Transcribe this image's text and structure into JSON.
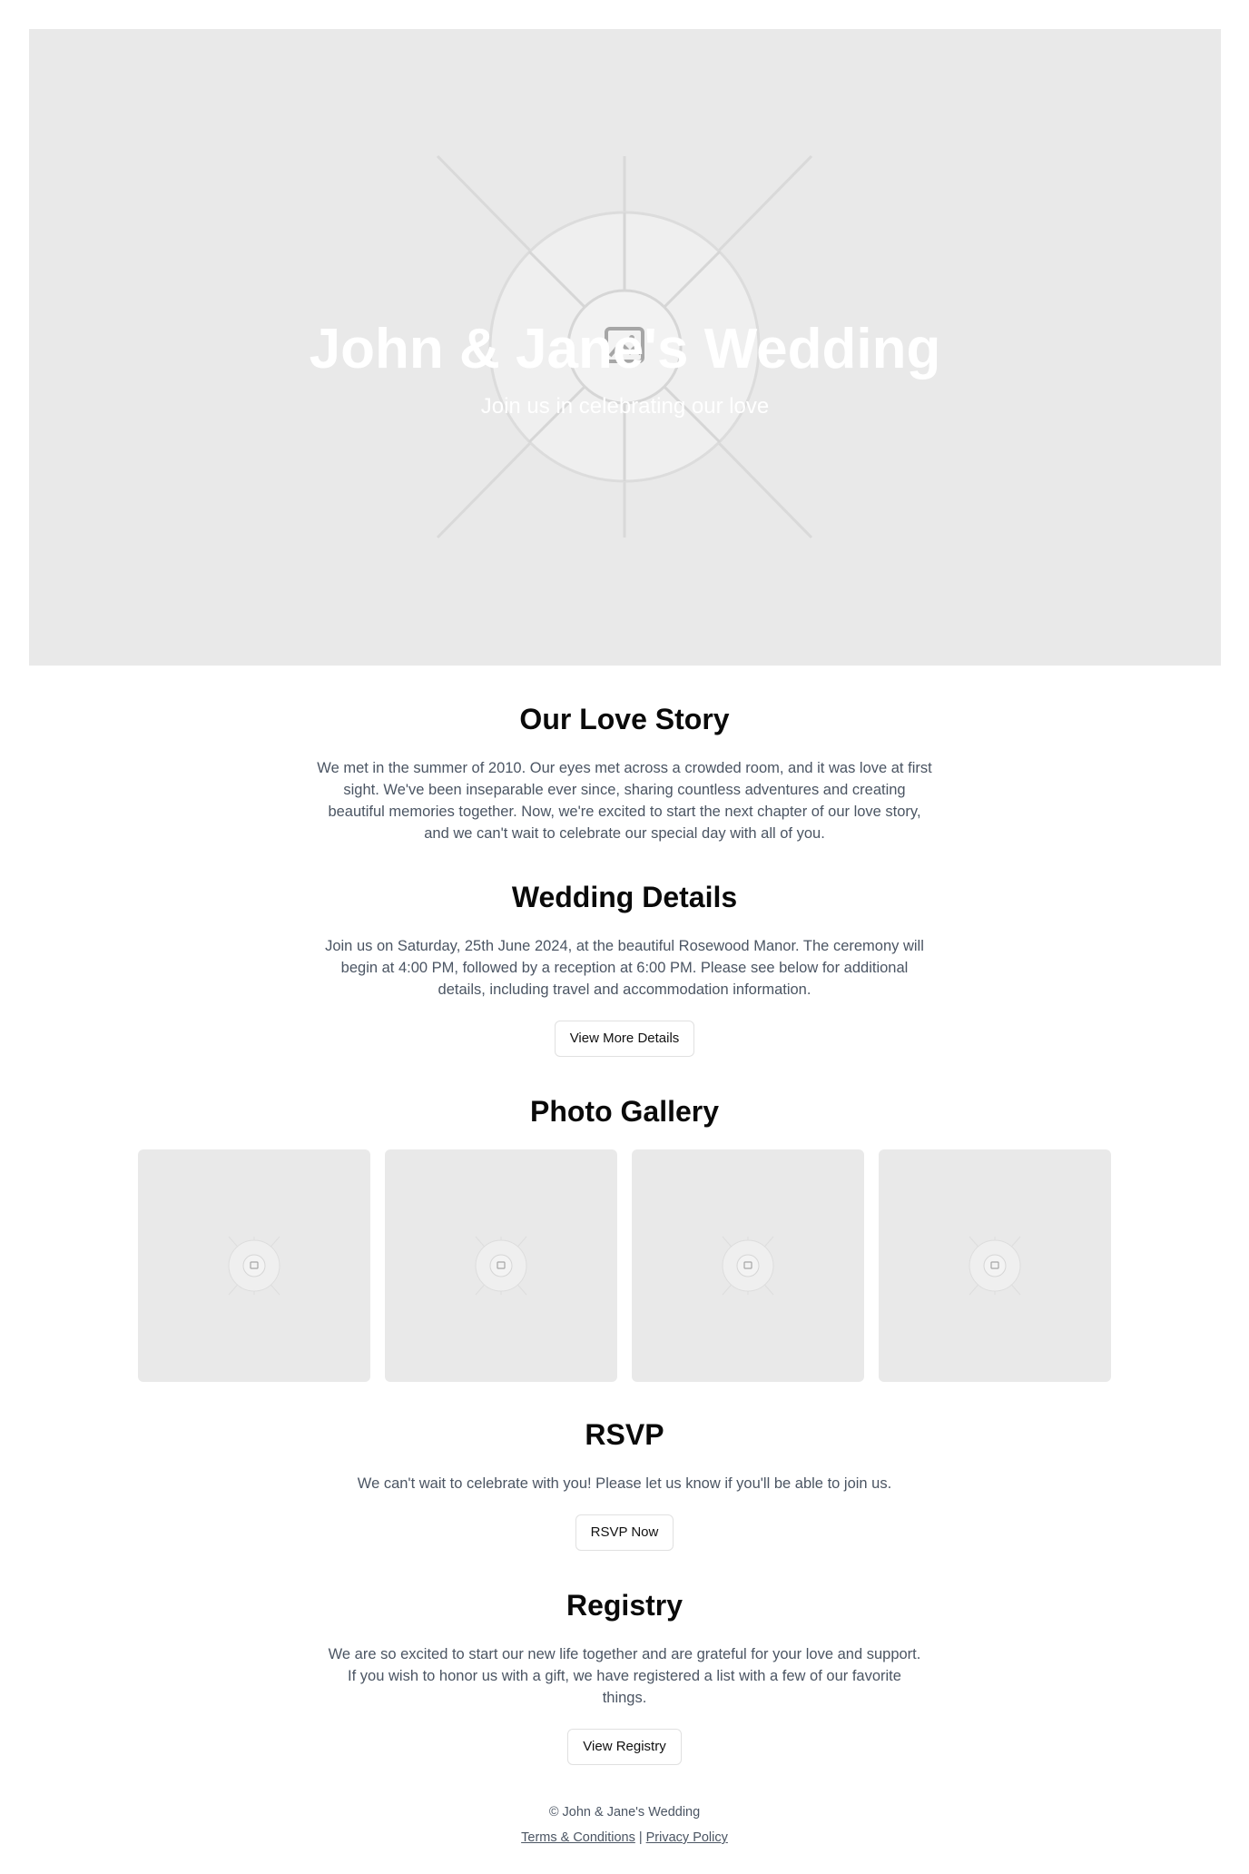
{
  "hero": {
    "title": "John & Jane's Wedding",
    "subtitle": "Join us in celebrating our love",
    "image_icon": "image-placeholder-icon"
  },
  "love_story": {
    "heading": "Our Love Story",
    "text": "We met in the summer of 2010. Our eyes met across a crowded room, and it was love at first sight. We've been inseparable ever since, sharing countless adventures and creating beautiful memories together. Now, we're excited to start the next chapter of our love story, and we can't wait to celebrate our special day with all of you."
  },
  "details": {
    "heading": "Wedding Details",
    "text": "Join us on Saturday, 25th June 2024, at the beautiful Rosewood Manor. The ceremony will begin at 4:00 PM, followed by a reception at 6:00 PM. Please see below for additional details, including travel and accommodation information.",
    "button": "View More Details"
  },
  "gallery": {
    "heading": "Photo Gallery",
    "photos": [
      "image-placeholder-icon",
      "image-placeholder-icon",
      "image-placeholder-icon",
      "image-placeholder-icon"
    ]
  },
  "rsvp": {
    "heading": "RSVP",
    "text": "We can't wait to celebrate with you! Please let us know if you'll be able to join us.",
    "button": "RSVP Now"
  },
  "registry": {
    "heading": "Registry",
    "text": "We are so excited to start our new life together and are grateful for your love and support. If you wish to honor us with a gift, we have registered a list with a few of our favorite things.",
    "button": "View Registry"
  },
  "footer": {
    "copyright": "© John & Jane's Wedding",
    "terms": "Terms & Conditions",
    "separator": "|",
    "privacy": "Privacy Policy"
  },
  "colors": {
    "placeholder_bg": "#e9e9e9",
    "body_text": "#4b5563",
    "heading": "#0a0a0a"
  }
}
